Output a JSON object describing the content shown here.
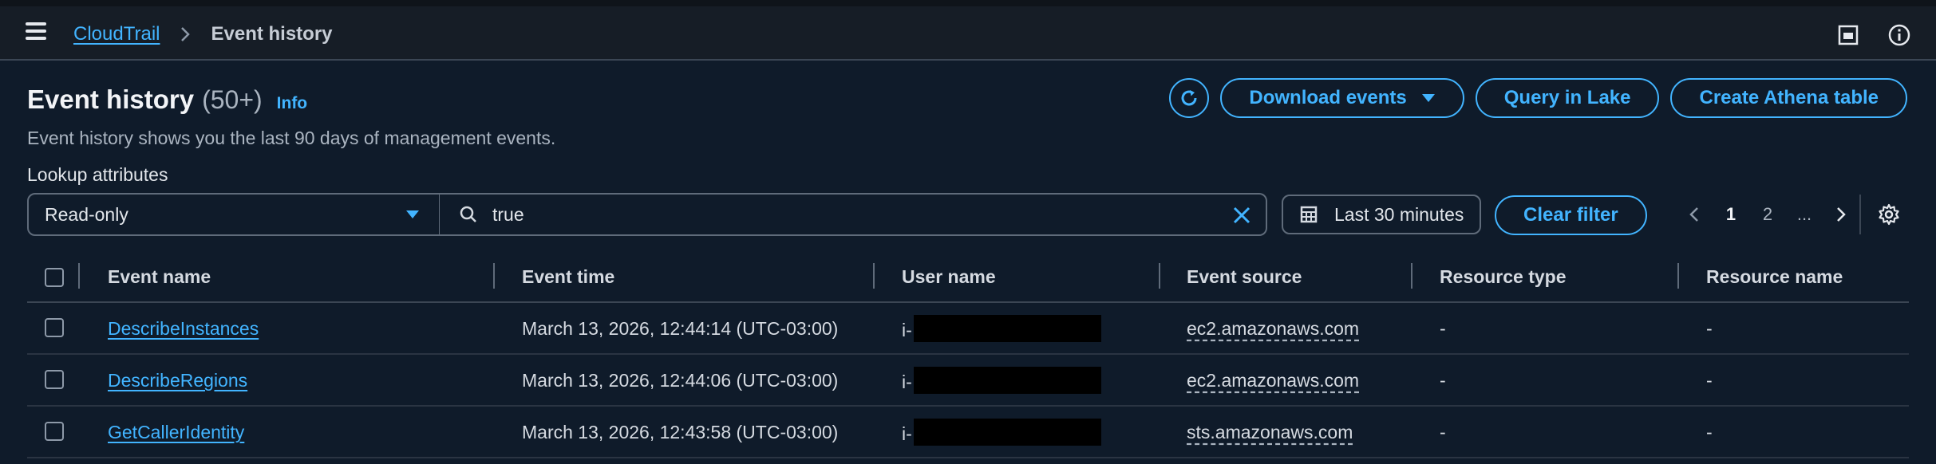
{
  "breadcrumb": {
    "root": "CloudTrail",
    "current": "Event history"
  },
  "header": {
    "title": "Event history",
    "count": "(50+)",
    "info_label": "Info",
    "description": "Event history shows you the last 90 days of management events."
  },
  "actions": {
    "download_label": "Download events",
    "query_label": "Query in Lake",
    "athena_label": "Create Athena table"
  },
  "lookup": {
    "label": "Lookup attributes",
    "attribute_value": "Read-only",
    "search_value": "true"
  },
  "time_range": {
    "label": "Last 30 minutes"
  },
  "clear_filter_label": "Clear filter",
  "pagination": {
    "pages": [
      "1",
      "2",
      "..."
    ],
    "current": "1"
  },
  "table": {
    "columns": [
      "Event name",
      "Event time",
      "User name",
      "Event source",
      "Resource type",
      "Resource name"
    ],
    "rows": [
      {
        "event_name": "DescribeInstances",
        "event_time": "March 13, 2026, 12:44:14 (UTC-03:00)",
        "user_prefix": "i-",
        "event_source": "ec2.amazonaws.com",
        "resource_type": "-",
        "resource_name": "-"
      },
      {
        "event_name": "DescribeRegions",
        "event_time": "March 13, 2026, 12:44:06 (UTC-03:00)",
        "user_prefix": "i-",
        "event_source": "ec2.amazonaws.com",
        "resource_type": "-",
        "resource_name": "-"
      },
      {
        "event_name": "GetCallerIdentity",
        "event_time": "March 13, 2026, 12:43:58 (UTC-03:00)",
        "user_prefix": "i-",
        "event_source": "sts.amazonaws.com",
        "resource_type": "-",
        "resource_name": "-"
      }
    ]
  },
  "colors": {
    "accent": "#42b4ff",
    "background": "#0f1b2a",
    "header_bg": "#161d26"
  },
  "icons": [
    "menu-icon",
    "chevron-right-icon",
    "panel-icon",
    "info-icon",
    "refresh-icon",
    "caret-down-icon",
    "search-icon",
    "close-icon",
    "calendar-icon",
    "chevron-left-icon",
    "gear-icon"
  ]
}
